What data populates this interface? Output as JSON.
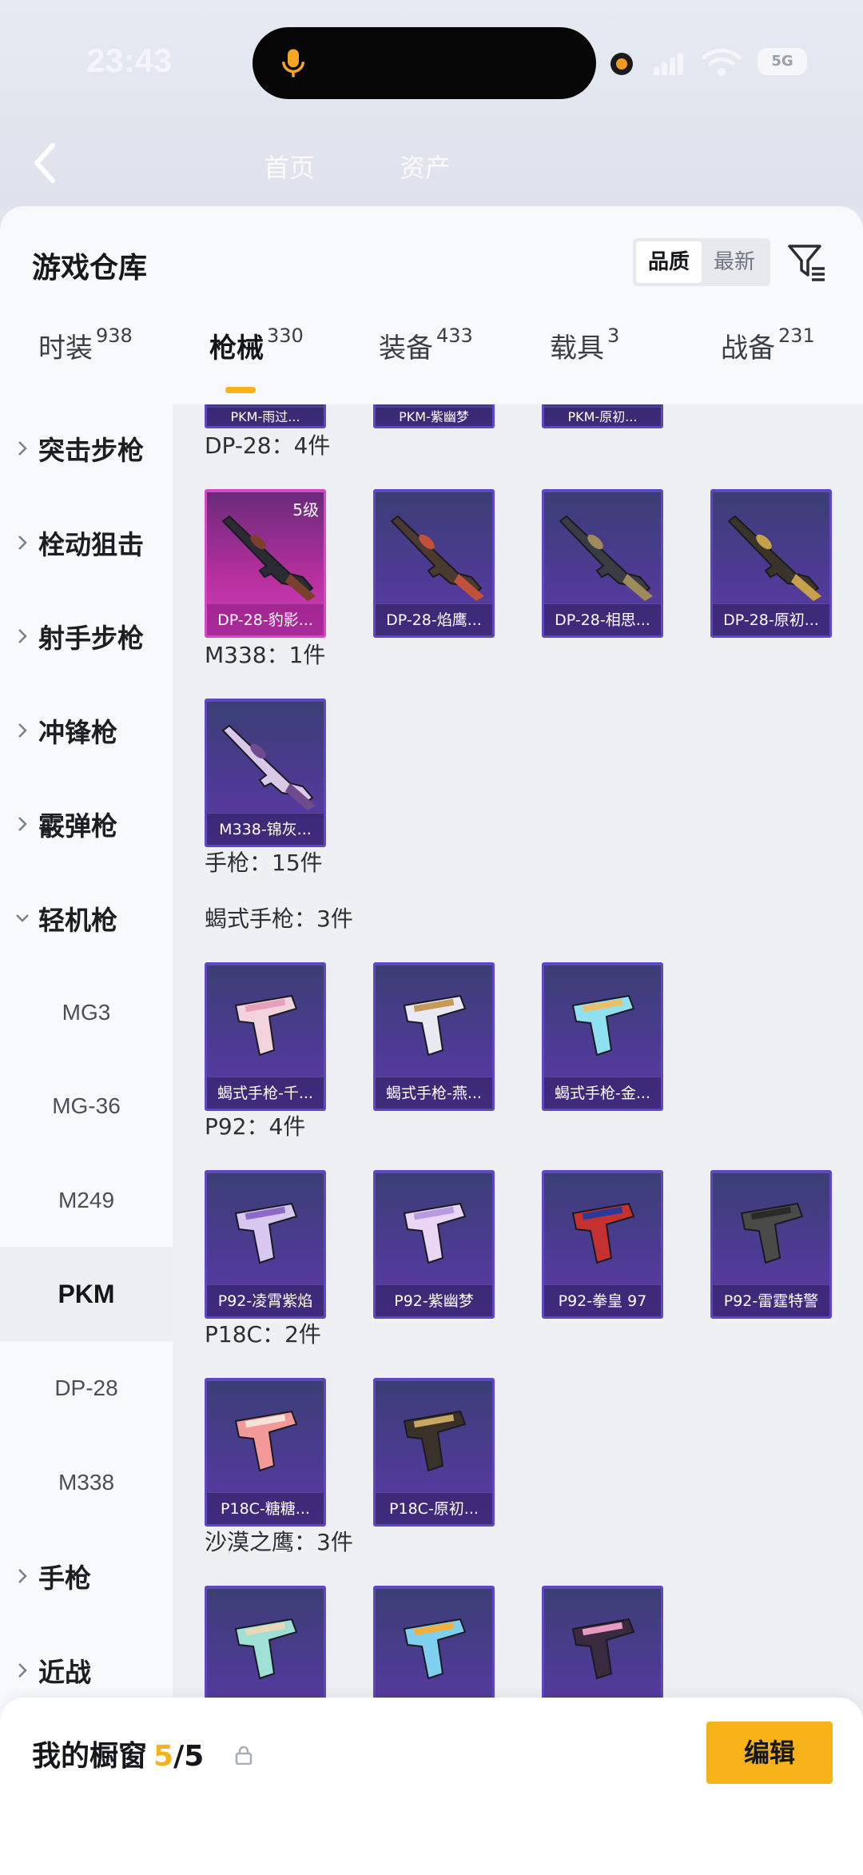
{
  "status_bar": {
    "time": "23:43",
    "battery": "5G"
  },
  "background_nav": {
    "items": [
      "首页",
      "资产"
    ]
  },
  "sheet": {
    "title": "游戏仓库",
    "sort_options": [
      {
        "label": "品质",
        "active": true
      },
      {
        "label": "最新",
        "active": false
      }
    ],
    "filter_icon": "filter-icon"
  },
  "tabs": [
    {
      "label": "时装",
      "count": "938",
      "active": false
    },
    {
      "label": "枪械",
      "count": "330",
      "active": true
    },
    {
      "label": "装备",
      "count": "433",
      "active": false
    },
    {
      "label": "载具",
      "count": "3",
      "active": false
    },
    {
      "label": "战备",
      "count": "231",
      "active": false
    }
  ],
  "sidebar": [
    {
      "label": "突击步枪",
      "type": "category",
      "expanded": false
    },
    {
      "label": "栓动狙击",
      "type": "category",
      "expanded": false
    },
    {
      "label": "射手步枪",
      "type": "category",
      "expanded": false
    },
    {
      "label": "冲锋枪",
      "type": "category",
      "expanded": false
    },
    {
      "label": "霰弹枪",
      "type": "category",
      "expanded": false
    },
    {
      "label": "轻机枪",
      "type": "category",
      "expanded": true
    },
    {
      "label": "MG3",
      "type": "sub"
    },
    {
      "label": "MG-36",
      "type": "sub"
    },
    {
      "label": "M249",
      "type": "sub"
    },
    {
      "label": "PKM",
      "type": "sub",
      "selected": true
    },
    {
      "label": "DP-28",
      "type": "sub"
    },
    {
      "label": "M338",
      "type": "sub"
    },
    {
      "label": "手枪",
      "type": "category",
      "expanded": false
    },
    {
      "label": "近战",
      "type": "category",
      "expanded": false
    }
  ],
  "content": {
    "partial_top_cards": [
      "PKM-雨过...",
      "PKM-紫幽梦",
      "PKM-原初..."
    ],
    "sections": [
      {
        "title": "DP-28：4件",
        "cards": [
          {
            "name": "DP-28-豹影...",
            "level": "5级",
            "rarity": "gold"
          },
          {
            "name": "DP-28-焰鹰..."
          },
          {
            "name": "DP-28-相思..."
          },
          {
            "name": "DP-28-原初..."
          }
        ]
      },
      {
        "title": "M338：1件",
        "cards": [
          {
            "name": "M338-锦灰..."
          }
        ]
      },
      {
        "title": "手枪：15件",
        "cards": []
      },
      {
        "title": "蝎式手枪：3件",
        "cards": [
          {
            "name": "蝎式手枪-千..."
          },
          {
            "name": "蝎式手枪-燕..."
          },
          {
            "name": "蝎式手枪-金..."
          }
        ]
      },
      {
        "title": "P92：4件",
        "cards": [
          {
            "name": "P92-凌霄紫焰"
          },
          {
            "name": "P92-紫幽梦"
          },
          {
            "name": "P92-拳皇 97"
          },
          {
            "name": "P92-雷霆特警"
          }
        ]
      },
      {
        "title": "P18C：2件",
        "cards": [
          {
            "name": "P18C-糖糖..."
          },
          {
            "name": "P18C-原初..."
          }
        ]
      },
      {
        "title": "沙漠之鹰：3件",
        "cards": [
          {
            "name": ""
          },
          {
            "name": ""
          },
          {
            "name": ""
          }
        ]
      }
    ]
  },
  "bottom_bar": {
    "title": "我的橱窗",
    "current": "5",
    "separator": "/",
    "total": "5",
    "edit_label": "编辑"
  },
  "fab_icon": "share-external-icon"
}
